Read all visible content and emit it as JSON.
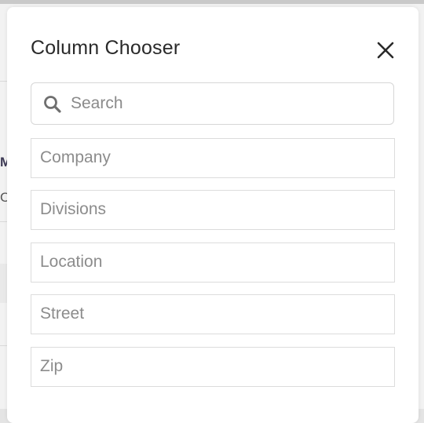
{
  "dialog": {
    "title": "Column Chooser",
    "close_icon": "close-icon"
  },
  "search": {
    "placeholder": "Search",
    "value": "",
    "icon": "search-icon"
  },
  "columns": [
    {
      "label": "Company"
    },
    {
      "label": "Divisions"
    },
    {
      "label": "Location"
    },
    {
      "label": "Street"
    },
    {
      "label": "Zip"
    }
  ],
  "colors": {
    "title_text": "#2a2a2a",
    "placeholder_text": "#8a8a8a",
    "border": "#dcdcdc",
    "dialog_background": "#ffffff",
    "backdrop": "#f2f2f2"
  }
}
